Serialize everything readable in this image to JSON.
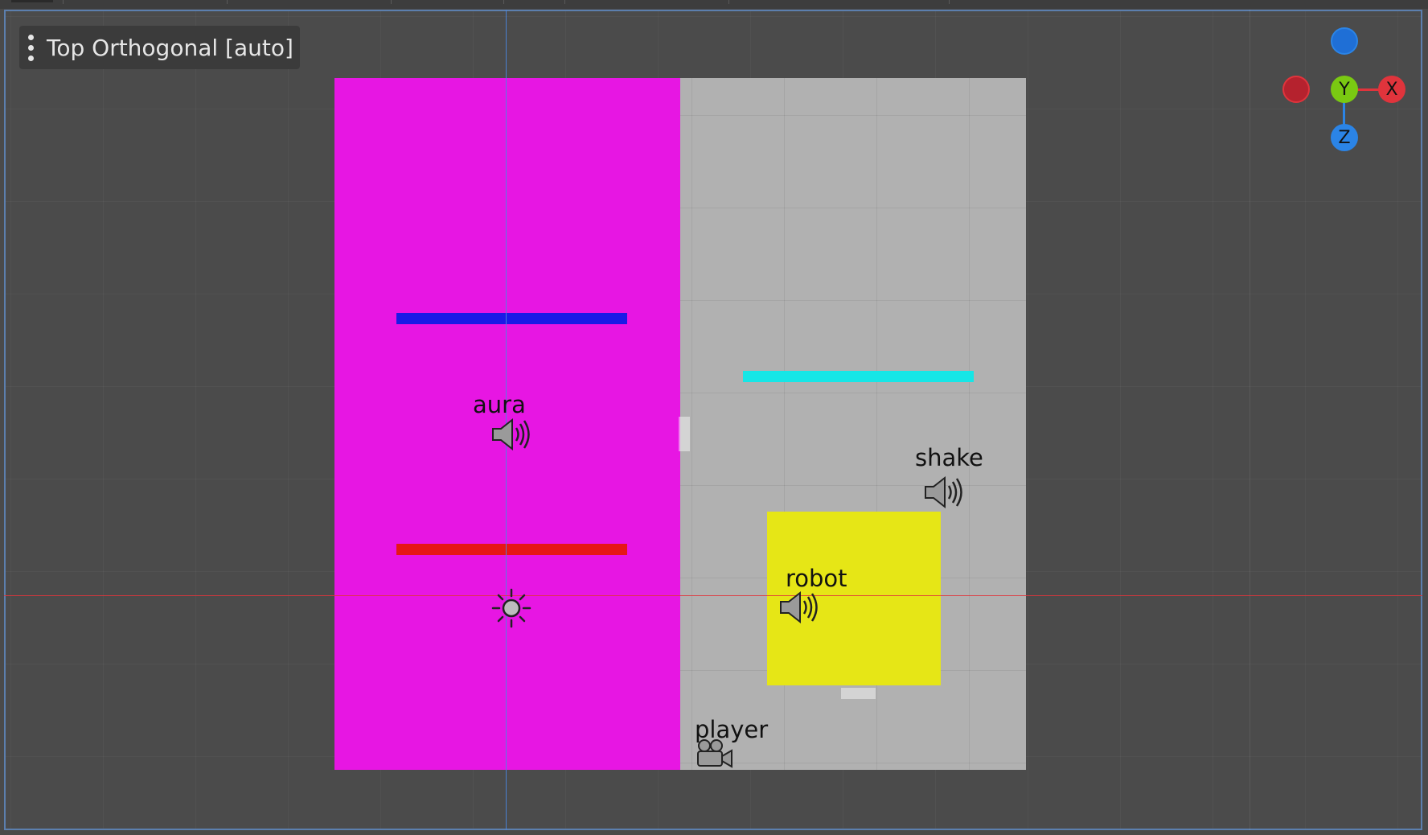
{
  "viewport": {
    "menu_label": "Top Orthogonal [auto]"
  },
  "nodes": {
    "aura": "aura",
    "shake": "shake",
    "robot": "robot",
    "player": "player"
  },
  "gizmo": {
    "x": "X",
    "y": "Y",
    "z": "Z"
  },
  "colors": {
    "left_floor": "#e716e3",
    "right_floor": "#b1b1b1",
    "blue_bar": "#1a1ae6",
    "red_bar": "#e61616",
    "cyan_bar": "#16e6e6",
    "yellow_box": "#e6e616",
    "axis_x": "#e0343c",
    "axis_y": "#7ac912",
    "axis_z": "#2b84e6"
  },
  "icons": {
    "speaker": "speaker-icon",
    "light": "light-icon",
    "camera": "camera-icon",
    "menu": "kebab-menu-icon"
  }
}
